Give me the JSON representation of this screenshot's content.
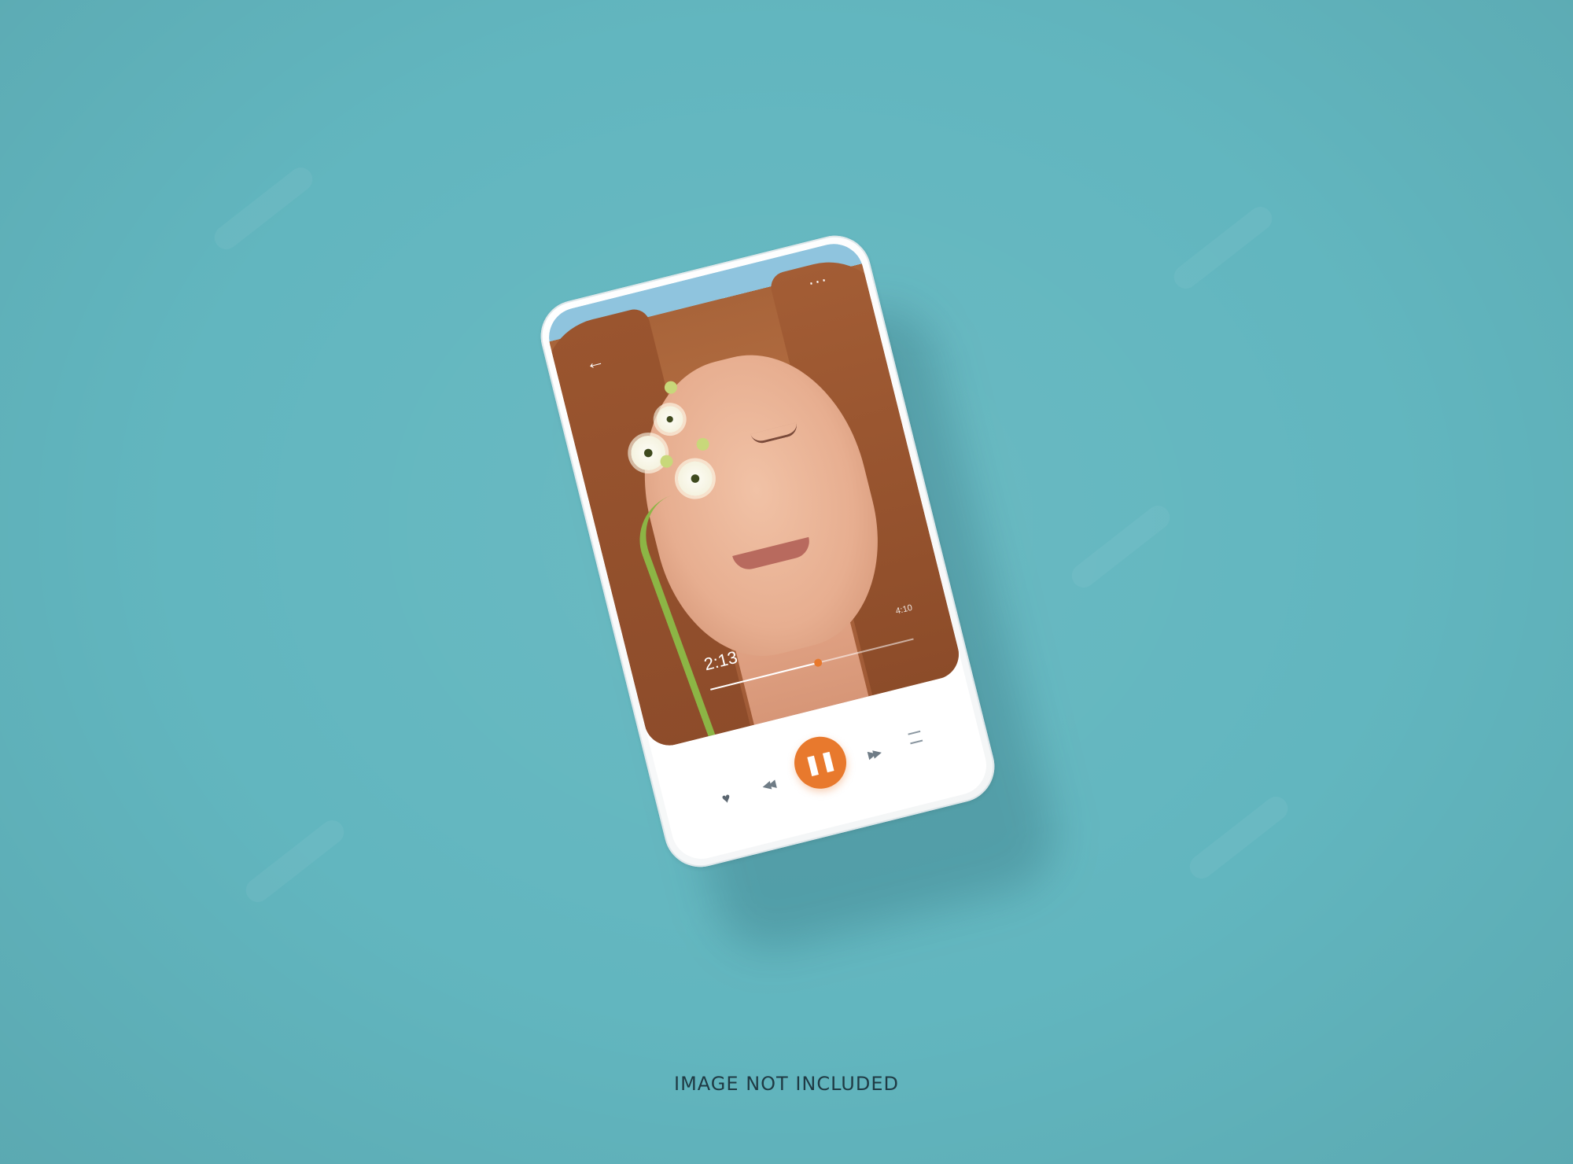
{
  "player": {
    "elapsed_time": "2:13",
    "total_time": "4:10",
    "progress_fraction": 0.53,
    "more_icon_glyph": "···",
    "back_icon": "back-arrow-icon",
    "more_icon": "more-dots-icon",
    "controls": {
      "like_icon": "heart-icon",
      "rewind_icon": "rewind-icon",
      "play_pause_icon": "pause-icon",
      "forward_icon": "fast-forward-icon",
      "playlist_icon": "playlist-icon"
    },
    "accent_color": "#e8792d"
  },
  "caption": "IMAGE NOT INCLUDED",
  "colors": {
    "background": "#62b6bf",
    "phone_body": "#ffffff"
  }
}
